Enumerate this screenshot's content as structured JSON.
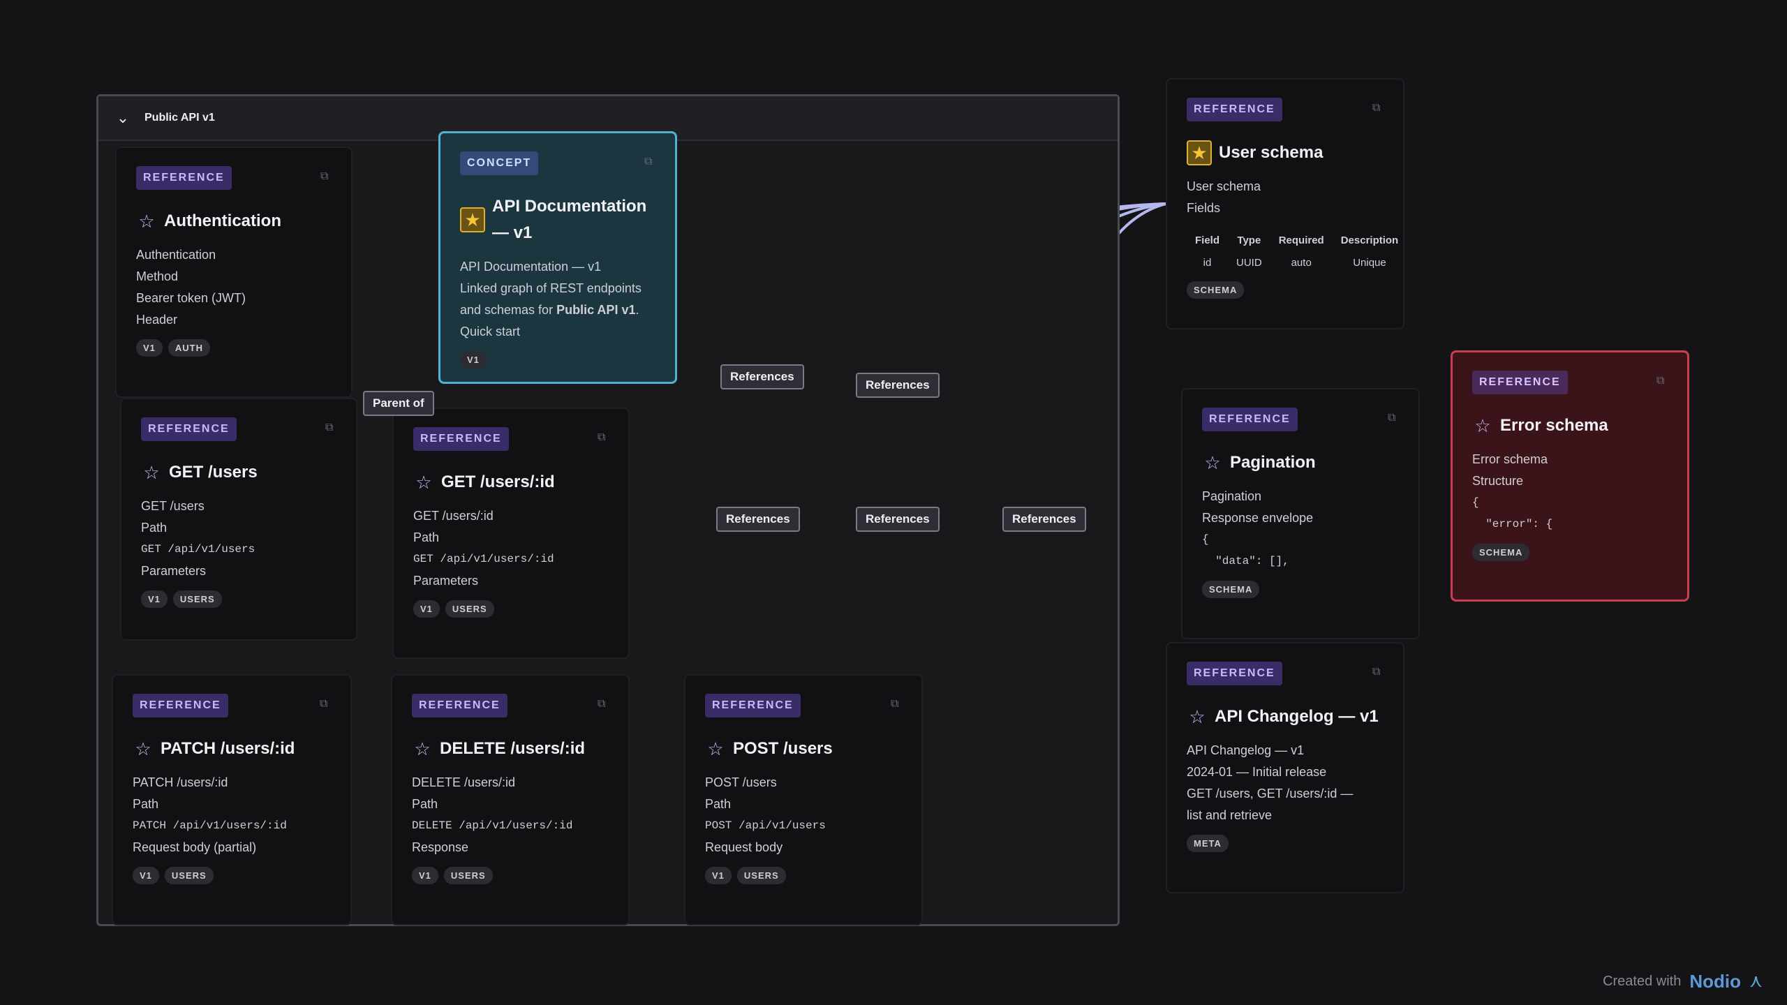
{
  "group": {
    "title": "Public API v1"
  },
  "cards": {
    "auth": {
      "tag": "REFERENCE",
      "title": "Authentication",
      "lines": [
        "Authentication",
        "Method",
        "Bearer token (JWT)",
        "Header"
      ],
      "chips": [
        "V1",
        "AUTH"
      ]
    },
    "api_doc": {
      "tag": "CONCEPT",
      "title": "API Documentation — v1",
      "lines": [
        "API Documentation — v1",
        "Linked graph of REST endpoints and schemas for",
        "Public API v1",
        ".",
        "Quick start"
      ],
      "chips": [
        "V1"
      ]
    },
    "get_users": {
      "tag": "REFERENCE",
      "title": "GET /users",
      "lines": [
        "GET /users",
        "Path",
        "GET /api/v1/users",
        "Parameters"
      ],
      "chips": [
        "V1",
        "USERS"
      ]
    },
    "get_user_id": {
      "tag": "REFERENCE",
      "title": "GET /users/:id",
      "lines": [
        "GET /users/:id",
        "Path",
        "GET /api/v1/users/:id",
        "Parameters"
      ],
      "chips": [
        "V1",
        "USERS"
      ]
    },
    "patch_user": {
      "tag": "REFERENCE",
      "title": "PATCH /users/:id",
      "lines": [
        "PATCH /users/:id",
        "Path",
        "PATCH /api/v1/users/:id",
        "Request body (partial)"
      ],
      "chips": [
        "V1",
        "USERS"
      ]
    },
    "delete_user": {
      "tag": "REFERENCE",
      "title": "DELETE /users/:id",
      "lines": [
        "DELETE /users/:id",
        "Path",
        "DELETE /api/v1/users/:id",
        "Response"
      ],
      "chips": [
        "V1",
        "USERS"
      ]
    },
    "post_users": {
      "tag": "REFERENCE",
      "title": "POST /users",
      "lines": [
        "POST /users",
        "Path",
        "POST /api/v1/users",
        "Request body"
      ],
      "chips": [
        "V1",
        "USERS"
      ]
    },
    "user_schema": {
      "tag": "REFERENCE",
      "title": "User schema",
      "lines": [
        "User schema",
        "Fields"
      ],
      "table_head": [
        "Field",
        "Type",
        "Required",
        "Description"
      ],
      "table_row": [
        "id",
        "UUID",
        "auto",
        "Unique"
      ],
      "chips": [
        "SCHEMA"
      ]
    },
    "pagination": {
      "tag": "REFERENCE",
      "title": "Pagination",
      "lines": [
        "Pagination",
        "Response envelope",
        "{",
        "  \"data\": [],"
      ],
      "chips": [
        "SCHEMA"
      ]
    },
    "error_schema": {
      "tag": "REFERENCE",
      "title": "Error schema",
      "lines": [
        "Error schema",
        "Structure",
        "{",
        "  \"error\": {"
      ],
      "chips": [
        "SCHEMA"
      ]
    },
    "changelog": {
      "tag": "REFERENCE",
      "title": "API Changelog — v1",
      "lines": [
        "API Changelog — v1",
        "2024-01 — Initial release",
        "GET /users, GET /users/:id —",
        "list and retrieve"
      ],
      "chips": [
        "META"
      ]
    }
  },
  "edge_labels": {
    "parent_of": "Parent of",
    "references": "References"
  },
  "footer": {
    "text": "Created with",
    "brand": "Nodio"
  },
  "colors": {
    "accent": "#4fb3d1",
    "edge": "#b8bcf0",
    "alert": "#c84050"
  }
}
